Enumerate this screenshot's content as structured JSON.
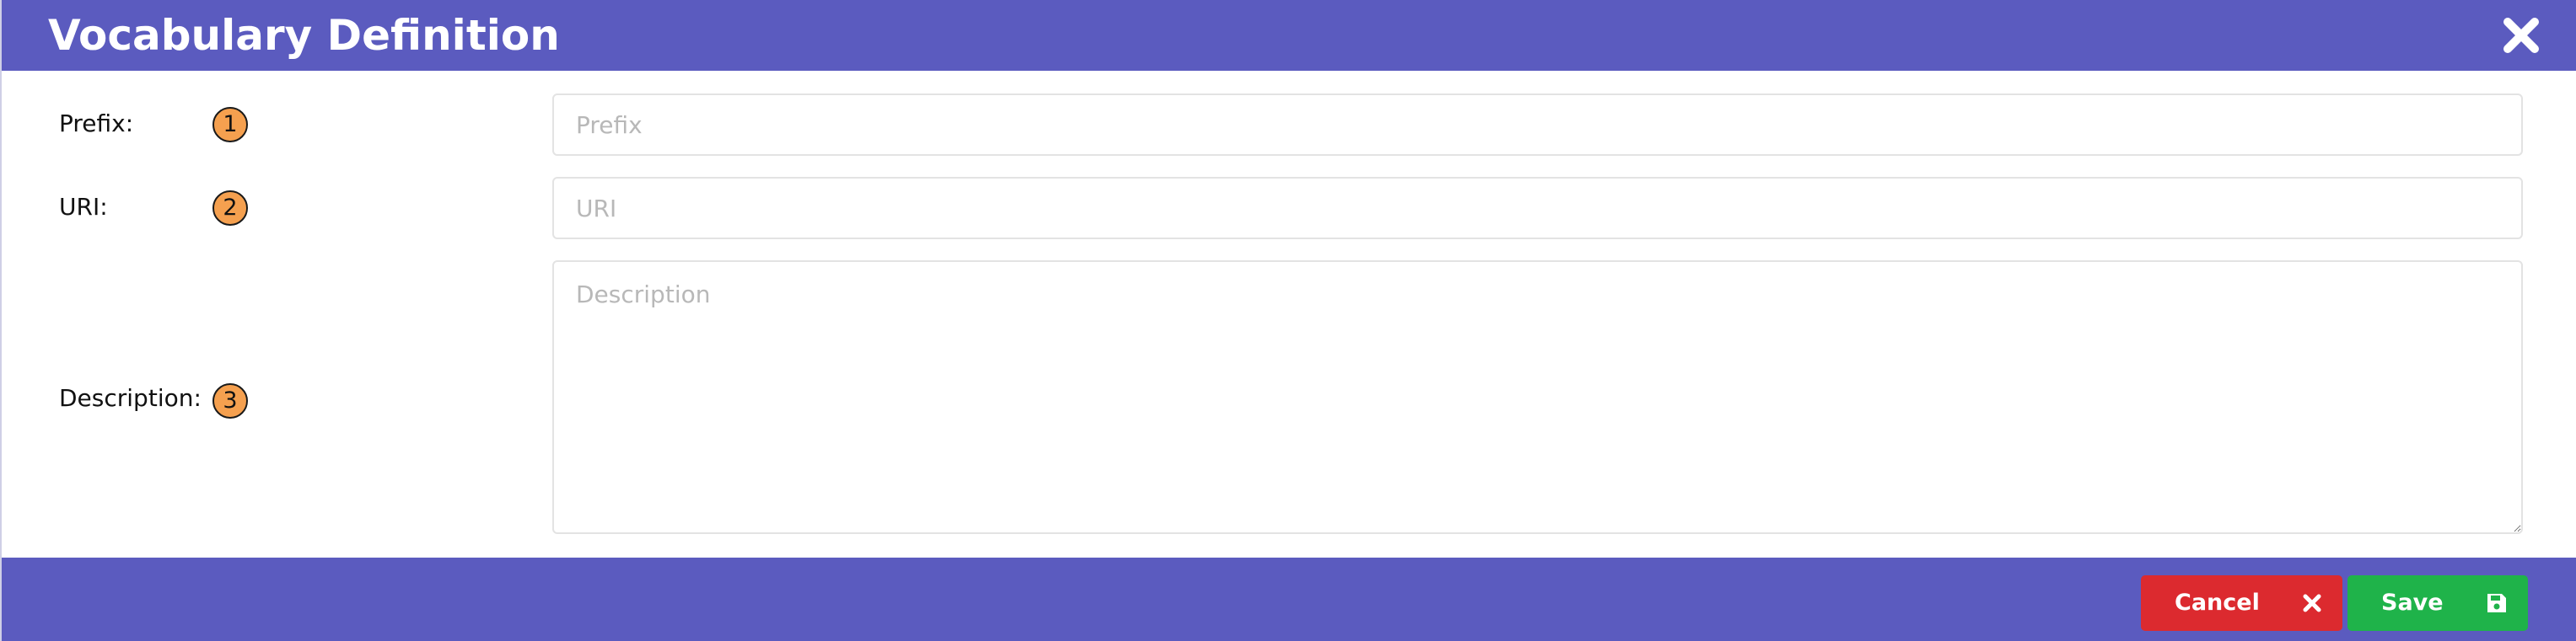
{
  "dialog": {
    "title": "Vocabulary Definition",
    "close_icon": "close-icon"
  },
  "form": {
    "prefix": {
      "label": "Prefix:",
      "badge": "1",
      "value": "",
      "placeholder": "Prefix"
    },
    "uri": {
      "label": "URI:",
      "badge": "2",
      "value": "",
      "placeholder": "URI"
    },
    "description": {
      "label": "Description:",
      "badge": "3",
      "value": "",
      "placeholder": "Description"
    }
  },
  "footer": {
    "cancel_label": "Cancel",
    "cancel_icon": "times-icon",
    "save_label": "Save",
    "save_icon": "floppy-disk-icon"
  },
  "colors": {
    "header_bg": "#5b5bbf",
    "badge_bg": "#f5a04f",
    "cancel_bg": "#dc2a2f",
    "save_bg": "#1fb34a"
  }
}
